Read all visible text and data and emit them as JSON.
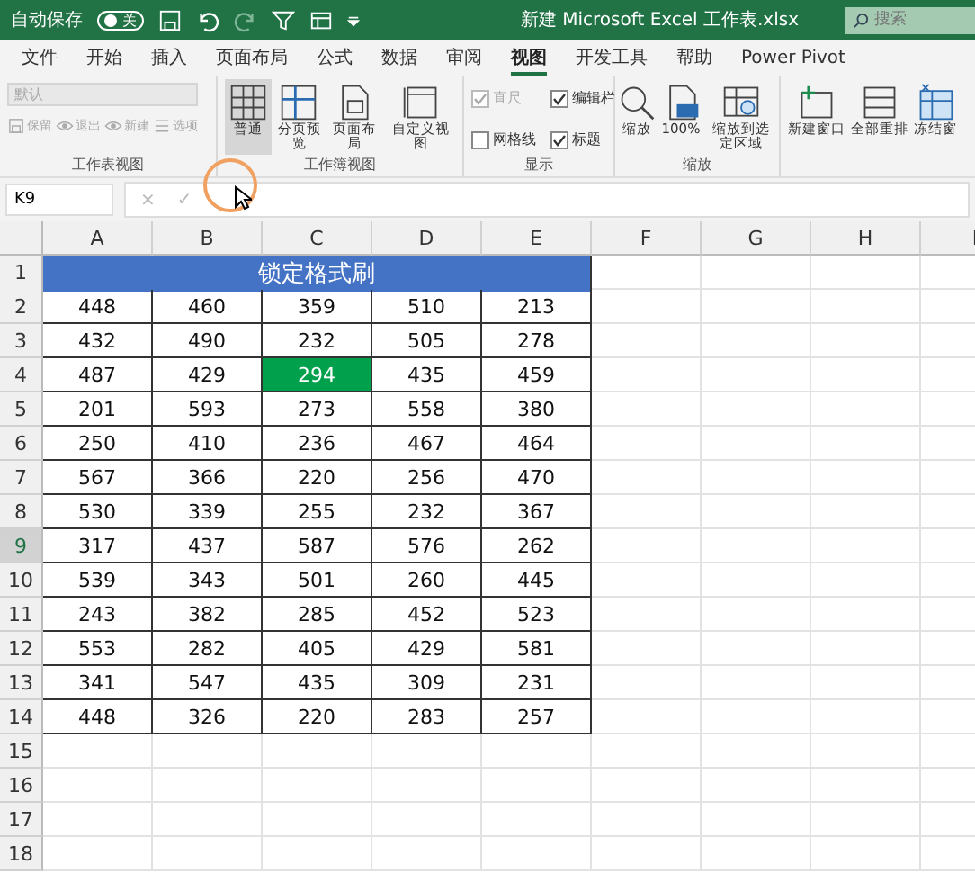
{
  "title_bar": {
    "autosave_label": "自动保存",
    "autosave_toggle": {
      "label": "关",
      "on": false
    },
    "title": "新建 Microsoft Excel 工作表.xlsx",
    "search": {
      "placeholder": "搜索"
    }
  },
  "tabs": [
    {
      "label": "文件",
      "selected": false
    },
    {
      "label": "开始",
      "selected": false
    },
    {
      "label": "插入",
      "selected": false
    },
    {
      "label": "页面布局",
      "selected": false
    },
    {
      "label": "公式",
      "selected": false
    },
    {
      "label": "数据",
      "selected": false
    },
    {
      "label": "审阅",
      "selected": false
    },
    {
      "label": "视图",
      "selected": true
    },
    {
      "label": "开发工具",
      "selected": false
    },
    {
      "label": "帮助",
      "selected": false
    },
    {
      "label": "Power Pivot",
      "selected": false
    }
  ],
  "ribbon": {
    "sheet_view": {
      "label": "工作表视图",
      "dropdown": "默认",
      "buttons": [
        {
          "label": "保留"
        },
        {
          "label": "退出"
        },
        {
          "label": "新建"
        },
        {
          "label": "选项"
        }
      ]
    },
    "workbook_views": {
      "label": "工作簿视图",
      "buttons": [
        {
          "label": "普通",
          "selected": true
        },
        {
          "label": "分页预览",
          "selected": false
        },
        {
          "label": "页面布局",
          "selected": false
        },
        {
          "label": "自定义视图",
          "selected": false
        }
      ]
    },
    "show": {
      "label": "显示",
      "checks": [
        {
          "label": "直尺",
          "checked": true,
          "disabled": true
        },
        {
          "label": "编辑栏",
          "checked": true,
          "disabled": false
        },
        {
          "label": "网格线",
          "checked": false,
          "disabled": false
        },
        {
          "label": "标题",
          "checked": true,
          "disabled": false
        }
      ]
    },
    "zoom": {
      "label": "缩放",
      "buttons": [
        {
          "label": "缩放"
        },
        {
          "label": "100%"
        },
        {
          "label": "缩放到选定区域"
        }
      ]
    },
    "window": {
      "buttons": [
        {
          "label": "新建窗口"
        },
        {
          "label": "全部重排"
        },
        {
          "label": "冻结窗"
        }
      ]
    }
  },
  "formula_bar": {
    "name_box": "K9",
    "cancel": "×",
    "enter": "✓"
  },
  "sheet": {
    "columns": [
      "A",
      "B",
      "C",
      "D",
      "E",
      "F",
      "G",
      "H",
      "I"
    ],
    "title_row": {
      "header": "1",
      "selected": false,
      "text": "锁定格式刷"
    },
    "rows": [
      {
        "header": "2",
        "selected": false,
        "cells": [
          {
            "value": "448",
            "highlighted": false
          },
          {
            "value": "460",
            "highlighted": false
          },
          {
            "value": "359",
            "highlighted": false
          },
          {
            "value": "510",
            "highlighted": false
          },
          {
            "value": "213",
            "highlighted": false
          }
        ]
      },
      {
        "header": "3",
        "selected": false,
        "cells": [
          {
            "value": "432",
            "highlighted": false
          },
          {
            "value": "490",
            "highlighted": false
          },
          {
            "value": "232",
            "highlighted": false
          },
          {
            "value": "505",
            "highlighted": false
          },
          {
            "value": "278",
            "highlighted": false
          }
        ]
      },
      {
        "header": "4",
        "selected": false,
        "cells": [
          {
            "value": "487",
            "highlighted": false
          },
          {
            "value": "429",
            "highlighted": false
          },
          {
            "value": "294",
            "highlighted": true
          },
          {
            "value": "435",
            "highlighted": false
          },
          {
            "value": "459",
            "highlighted": false
          }
        ]
      },
      {
        "header": "5",
        "selected": false,
        "cells": [
          {
            "value": "201",
            "highlighted": false
          },
          {
            "value": "593",
            "highlighted": false
          },
          {
            "value": "273",
            "highlighted": false
          },
          {
            "value": "558",
            "highlighted": false
          },
          {
            "value": "380",
            "highlighted": false
          }
        ]
      },
      {
        "header": "6",
        "selected": false,
        "cells": [
          {
            "value": "250",
            "highlighted": false
          },
          {
            "value": "410",
            "highlighted": false
          },
          {
            "value": "236",
            "highlighted": false
          },
          {
            "value": "467",
            "highlighted": false
          },
          {
            "value": "464",
            "highlighted": false
          }
        ]
      },
      {
        "header": "7",
        "selected": false,
        "cells": [
          {
            "value": "567",
            "highlighted": false
          },
          {
            "value": "366",
            "highlighted": false
          },
          {
            "value": "220",
            "highlighted": false
          },
          {
            "value": "256",
            "highlighted": false
          },
          {
            "value": "470",
            "highlighted": false
          }
        ]
      },
      {
        "header": "8",
        "selected": false,
        "cells": [
          {
            "value": "530",
            "highlighted": false
          },
          {
            "value": "339",
            "highlighted": false
          },
          {
            "value": "255",
            "highlighted": false
          },
          {
            "value": "232",
            "highlighted": false
          },
          {
            "value": "367",
            "highlighted": false
          }
        ]
      },
      {
        "header": "9",
        "selected": true,
        "cells": [
          {
            "value": "317",
            "highlighted": false
          },
          {
            "value": "437",
            "highlighted": false
          },
          {
            "value": "587",
            "highlighted": false
          },
          {
            "value": "576",
            "highlighted": false
          },
          {
            "value": "262",
            "highlighted": false
          }
        ]
      },
      {
        "header": "10",
        "selected": false,
        "cells": [
          {
            "value": "539",
            "highlighted": false
          },
          {
            "value": "343",
            "highlighted": false
          },
          {
            "value": "501",
            "highlighted": false
          },
          {
            "value": "260",
            "highlighted": false
          },
          {
            "value": "445",
            "highlighted": false
          }
        ]
      },
      {
        "header": "11",
        "selected": false,
        "cells": [
          {
            "value": "243",
            "highlighted": false
          },
          {
            "value": "382",
            "highlighted": false
          },
          {
            "value": "285",
            "highlighted": false
          },
          {
            "value": "452",
            "highlighted": false
          },
          {
            "value": "523",
            "highlighted": false
          }
        ]
      },
      {
        "header": "12",
        "selected": false,
        "cells": [
          {
            "value": "553",
            "highlighted": false
          },
          {
            "value": "282",
            "highlighted": false
          },
          {
            "value": "405",
            "highlighted": false
          },
          {
            "value": "429",
            "highlighted": false
          },
          {
            "value": "581",
            "highlighted": false
          }
        ]
      },
      {
        "header": "13",
        "selected": false,
        "cells": [
          {
            "value": "341",
            "highlighted": false
          },
          {
            "value": "547",
            "highlighted": false
          },
          {
            "value": "435",
            "highlighted": false
          },
          {
            "value": "309",
            "highlighted": false
          },
          {
            "value": "231",
            "highlighted": false
          }
        ]
      },
      {
        "header": "14",
        "selected": false,
        "cells": [
          {
            "value": "448",
            "highlighted": false
          },
          {
            "value": "326",
            "highlighted": false
          },
          {
            "value": "220",
            "highlighted": false
          },
          {
            "value": "283",
            "highlighted": false
          },
          {
            "value": "257",
            "highlighted": false
          }
        ]
      }
    ],
    "empty_rows": [
      {
        "header": "15",
        "selected": false
      },
      {
        "header": "16",
        "selected": false
      },
      {
        "header": "17",
        "selected": false
      },
      {
        "header": "18",
        "selected": false
      }
    ]
  }
}
